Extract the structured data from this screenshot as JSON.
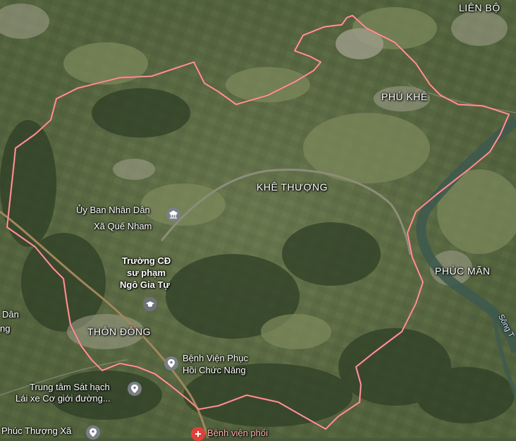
{
  "map": {
    "places": {
      "lien_bo": "LIÊN BỘ",
      "phu_khe": "PHÚ KHÊ",
      "khe_thuong": "KHÊ THƯỢNG",
      "phuc_man": "PHÚC MÃN",
      "thon_dong": "THÔN ĐÔNG"
    },
    "pois": {
      "ubnd_line1": "Ủy Ban Nhân Dân",
      "ubnd_line2": "Xã Quế Nham",
      "truong_line1": "Trường CĐ",
      "truong_line2": "sư phạm",
      "truong_line3": "Ngô Gia Tự",
      "bv_phcn_line1": "Bệnh Viện Phục",
      "bv_phcn_line2": "Hồi Chức Năng",
      "trung_tam_line1": "Trung tâm Sát hạch",
      "trung_tam_line2": "Lái xe Cơ giới đường...",
      "phuc_thuong": "Phúc Thượng Xã",
      "bv_phoi": "Bệnh viện phổi",
      "dan_partial_1": "Dân",
      "dan_partial_2": "ng"
    },
    "river_label": "Sông T",
    "colors": {
      "boundary": "#e8646a",
      "river": "#3e5a4e",
      "road": "#8c8c7a",
      "poi_gray": "#7a7f86",
      "school_gray": "#6d7278",
      "hospital_red": "#e0403a"
    }
  }
}
